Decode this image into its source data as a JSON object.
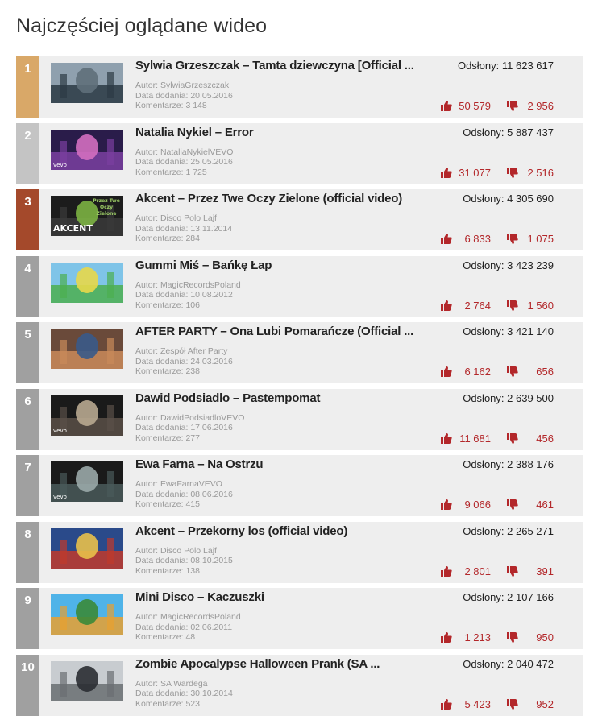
{
  "page": {
    "title": "Najczęściej oglądane wideo"
  },
  "labels": {
    "views": "Odsłony:",
    "author": "Autor:",
    "date": "Data dodania:",
    "comments": "Komentarze:"
  },
  "colors": {
    "rank1": "#d9a868",
    "rank2": "#c4c4c4",
    "rank3": "#a4492b",
    "rank_other": "#a0a0a0",
    "vote_red": "#b3272a",
    "row_bg": "#eeeeee"
  },
  "videos": [
    {
      "rank": "1",
      "title": "Sylwia Grzeszczak – Tamta dziewczyna [Official ...",
      "author": "SylwiaGrzeszczak",
      "date": "20.05.2016",
      "comments": "3 148",
      "views": "11 623 617",
      "likes": "50 579",
      "dislikes": "2 956",
      "thumb_badge": ""
    },
    {
      "rank": "2",
      "title": "Natalia Nykiel – Error",
      "author": "NataliaNykielVEVO",
      "date": "25.05.2016",
      "comments": "1 725",
      "views": "5 887 437",
      "likes": "31 077",
      "dislikes": "2 516",
      "thumb_badge": "vevo"
    },
    {
      "rank": "3",
      "title": "Akcent – Przez Twe Oczy Zielone (official video)",
      "author": "Disco Polo Lajf",
      "date": "13.11.2014",
      "comments": "284",
      "views": "4 305 690",
      "likes": "6 833",
      "dislikes": "1 075",
      "thumb_badge": "AKCENT",
      "thumb_caption": "Przez Twe Oczy Zielone"
    },
    {
      "rank": "4",
      "title": "Gummi Miś – Bańkę Łap",
      "author": "MagicRecordsPoland",
      "date": "10.08.2012",
      "comments": "106",
      "views": "3 423 239",
      "likes": "2 764",
      "dislikes": "1 560",
      "thumb_badge": ""
    },
    {
      "rank": "5",
      "title": "AFTER PARTY – Ona Lubi Pomarańcze (Official ...",
      "author": "Zespół After Party",
      "date": "24.03.2016",
      "comments": "238",
      "views": "3 421 140",
      "likes": "6 162",
      "dislikes": "656",
      "thumb_badge": ""
    },
    {
      "rank": "6",
      "title": "Dawid Podsiadlo – Pastempomat",
      "author": "DawidPodsiadloVEVO",
      "date": "17.06.2016",
      "comments": "277",
      "views": "2 639 500",
      "likes": "11 681",
      "dislikes": "456",
      "thumb_badge": "vevo"
    },
    {
      "rank": "7",
      "title": "Ewa Farna – Na Ostrzu",
      "author": "EwaFarnaVEVO",
      "date": "08.06.2016",
      "comments": "415",
      "views": "2 388 176",
      "likes": "9 066",
      "dislikes": "461",
      "thumb_badge": "vevo"
    },
    {
      "rank": "8",
      "title": "Akcent – Przekorny los (official video)",
      "author": "Disco Polo Lajf",
      "date": "08.10.2015",
      "comments": "138",
      "views": "2 265 271",
      "likes": "2 801",
      "dislikes": "391",
      "thumb_badge": ""
    },
    {
      "rank": "9",
      "title": "Mini Disco – Kaczuszki",
      "author": "MagicRecordsPoland",
      "date": "02.06.2011",
      "comments": "48",
      "views": "2 107 166",
      "likes": "1 213",
      "dislikes": "950",
      "thumb_badge": ""
    },
    {
      "rank": "10",
      "title": "Zombie Apocalypse Halloween Prank (SA ...",
      "author": "SA Wardega",
      "date": "30.10.2014",
      "comments": "523",
      "views": "2 040 472",
      "likes": "5 423",
      "dislikes": "952",
      "thumb_badge": ""
    }
  ]
}
